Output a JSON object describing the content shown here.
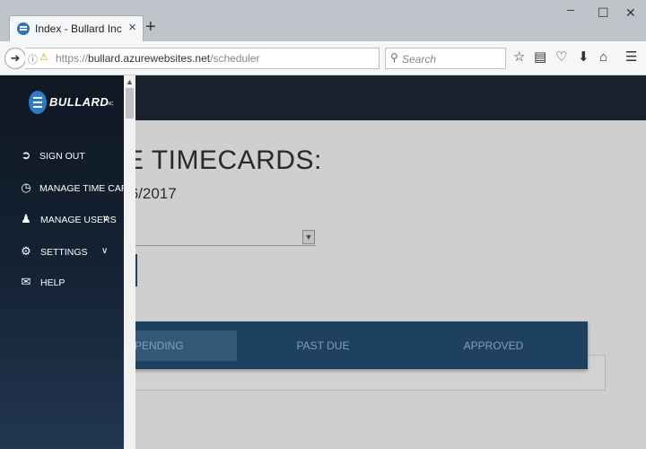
{
  "browser": {
    "tab_title": "Index - Bullard Inc",
    "tab_close": "×",
    "new_tab": "+",
    "window_controls": {
      "minimize": "–",
      "maximize": "☐",
      "close": "✕"
    },
    "url_prefix": "https://",
    "url_host": "bullard.azurewebsites.net",
    "url_path": "/scheduler",
    "search_placeholder": "Search",
    "toolbar_icons": [
      "star-icon",
      "reading-list-icon",
      "pocket-icon",
      "download-icon",
      "home-icon",
      "menu-icon"
    ]
  },
  "sidebar": {
    "logo_text": "BULLARD",
    "logo_suffix": "INC",
    "items": [
      {
        "label": "SIGN OUT",
        "icon": "sign-out-icon"
      },
      {
        "label": "MANAGE TIME CARD",
        "icon": "clock-icon"
      },
      {
        "label": "MANAGE USERS",
        "icon": "users-icon"
      },
      {
        "label": "SETTINGS",
        "icon": "cogs-icon"
      },
      {
        "label": "HELP",
        "icon": "envelope-icon"
      }
    ]
  },
  "page": {
    "title": "E TIMECARDS:",
    "date": "/6/2017",
    "status_tabs": [
      {
        "label": "PENDING",
        "active": true
      },
      {
        "label": "PAST DUE",
        "active": false
      },
      {
        "label": "APPROVED",
        "active": false
      }
    ]
  },
  "colors": {
    "sidebar_top": "#0f1722",
    "sidebar_bottom": "#213650",
    "topbar": "#1d2734",
    "tabs_panel": "#234b6f",
    "logo_blue": "#2d7cc4"
  }
}
